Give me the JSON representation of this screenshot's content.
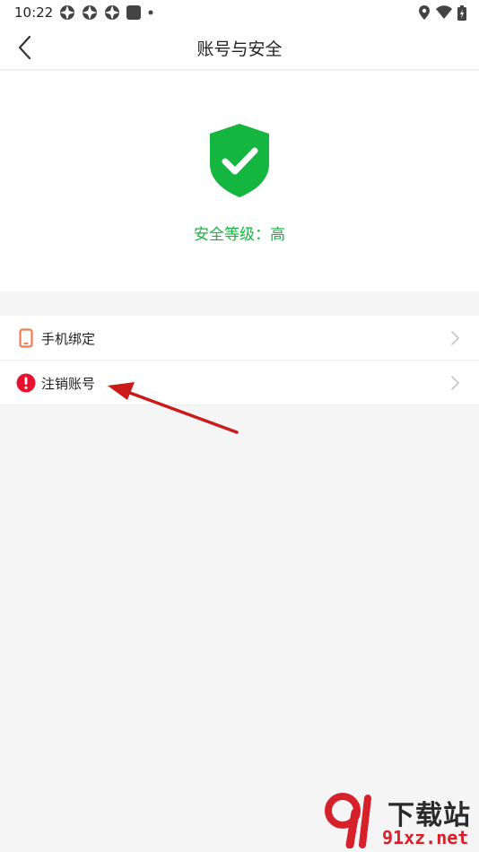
{
  "status_bar": {
    "time": "10:22",
    "left_icons": [
      "notification-app-icon",
      "notification-app-icon",
      "notification-app-icon",
      "notification-square-icon",
      "dot-icon"
    ],
    "right_icons": [
      "location-icon",
      "wifi-icon",
      "battery-icon"
    ]
  },
  "header": {
    "title": "账号与安全",
    "back_icon": "chevron-left-icon"
  },
  "security": {
    "icon": "shield-check-icon",
    "level_text": "安全等级：高",
    "color": "#15b640"
  },
  "list": {
    "items": [
      {
        "label": "手机绑定",
        "icon": "phone-icon",
        "icon_color": "#f47a4f"
      },
      {
        "label": "注销账号",
        "icon": "alert-circle-icon",
        "icon_color": "#e8112d"
      }
    ]
  },
  "annotation": {
    "arrow_color": "#cc1a1a"
  },
  "watermark": {
    "top_text": "下载站",
    "bottom_text": "91xz.net"
  }
}
